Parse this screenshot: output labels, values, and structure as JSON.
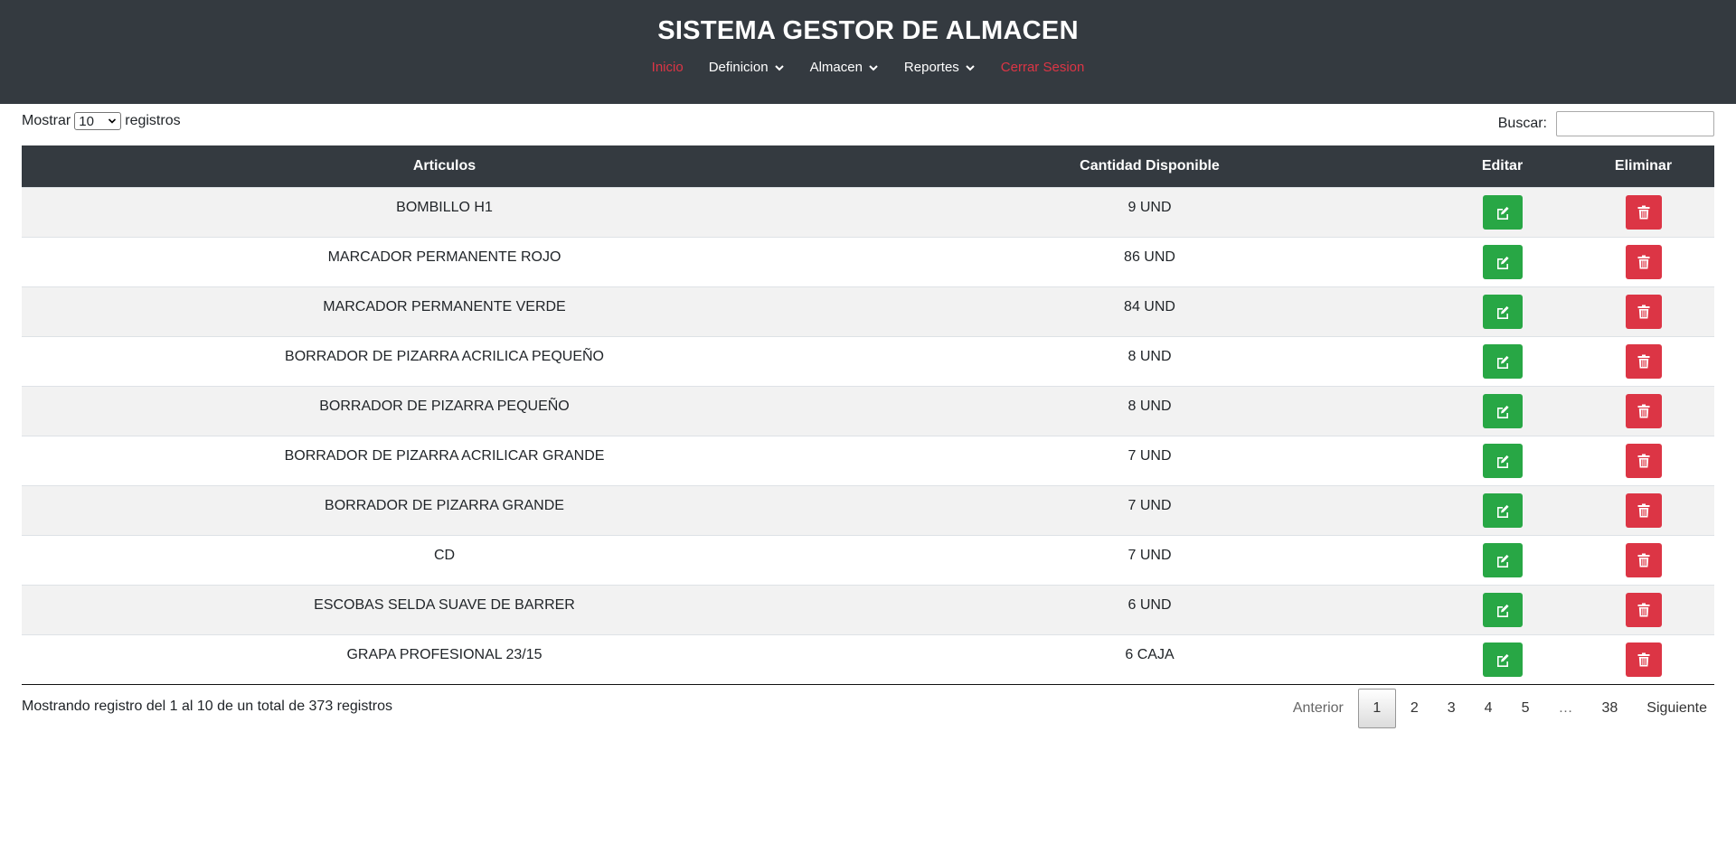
{
  "header": {
    "title": "SISTEMA GESTOR DE ALMACEN",
    "nav": [
      {
        "label": "Inicio"
      },
      {
        "label": "Definicion"
      },
      {
        "label": "Almacen"
      },
      {
        "label": "Reportes"
      },
      {
        "label": "Cerrar Sesion"
      }
    ]
  },
  "controls": {
    "show_label": "Mostrar",
    "page_size": "10",
    "records_label": "registros",
    "search_label": "Buscar:",
    "search_value": ""
  },
  "table": {
    "columns": [
      "Articulos",
      "Cantidad Disponible",
      "Editar",
      "Eliminar"
    ],
    "rows": [
      {
        "articulo": "BOMBILLO H1",
        "cantidad": "9 UND"
      },
      {
        "articulo": "MARCADOR PERMANENTE ROJO",
        "cantidad": "86 UND"
      },
      {
        "articulo": "MARCADOR PERMANENTE VERDE",
        "cantidad": "84 UND"
      },
      {
        "articulo": "BORRADOR DE PIZARRA ACRILICA PEQUEÑO",
        "cantidad": "8 UND"
      },
      {
        "articulo": "BORRADOR DE PIZARRA PEQUEÑO",
        "cantidad": "8 UND"
      },
      {
        "articulo": "BORRADOR DE PIZARRA ACRILICAR GRANDE",
        "cantidad": "7 UND"
      },
      {
        "articulo": "BORRADOR DE PIZARRA GRANDE",
        "cantidad": "7 UND"
      },
      {
        "articulo": "CD",
        "cantidad": "7 UND"
      },
      {
        "articulo": "ESCOBAS SELDA SUAVE DE BARRER",
        "cantidad": "6 UND"
      },
      {
        "articulo": "GRAPA PROFESIONAL 23/15",
        "cantidad": "6 CAJA"
      }
    ]
  },
  "footer": {
    "info": "Mostrando registro del 1 al 10 de un total de 373 registros",
    "pagination": {
      "previous": "Anterior",
      "pages": [
        "1",
        "2",
        "3",
        "4",
        "5"
      ],
      "ellipsis": "…",
      "last": "38",
      "next": "Siguiente",
      "current": "1"
    }
  },
  "colors": {
    "header_bg": "#343a40",
    "nav_active": "#dc3545",
    "edit_button": "#28a745",
    "delete_button": "#dc3545",
    "row_stripe": "#f2f2f2"
  },
  "icons": {
    "edit": "edit-icon",
    "delete": "trash-icon",
    "dropdown": "chevron-down-icon"
  }
}
